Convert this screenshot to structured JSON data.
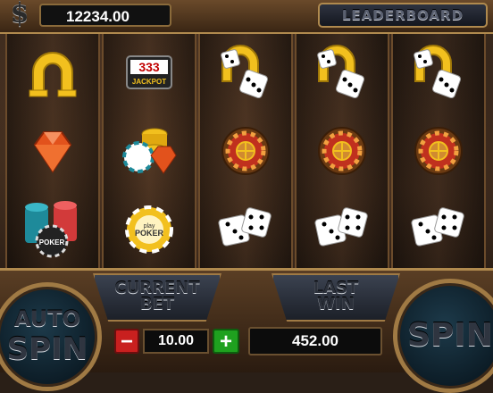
{
  "header": {
    "currency_icon": "$",
    "balance": "12234.00",
    "leaderboard_label": "LEADERBOARD"
  },
  "reels": [
    [
      "horseshoe-icon",
      "ruby-gem-icon",
      "poker-chip-stack-icon"
    ],
    [
      "jackpot-333-icon",
      "chips-and-ruby-icon",
      "play-poker-chip-icon"
    ],
    [
      "horseshoe-dice-icon",
      "roulette-wheel-icon",
      "dice-icon"
    ],
    [
      "horseshoe-dice-icon",
      "roulette-wheel-icon",
      "dice-icon"
    ],
    [
      "horseshoe-dice-icon",
      "roulette-wheel-icon",
      "dice-icon"
    ]
  ],
  "symbol_text": {
    "jackpot_digits": "333",
    "jackpot_label": "JACKPOT",
    "poker_chip_small": "POKER",
    "play_small": "play",
    "play_big": "POKER"
  },
  "controls": {
    "auto_line1": "AUTO",
    "auto_line2": "SPIN",
    "current_bet_line1": "CURRENT",
    "current_bet_line2": "BET",
    "minus_label": "−",
    "bet_value": "10.00",
    "plus_label": "+",
    "last_win_line1": "LAST",
    "last_win_line2": "WIN",
    "last_win_value": "452.00",
    "spin_label": "SPIN"
  },
  "colors": {
    "gold": "#f2c01e",
    "ruby": "#e2521c",
    "minus_red": "#c9201f",
    "plus_green": "#1fa11f"
  }
}
